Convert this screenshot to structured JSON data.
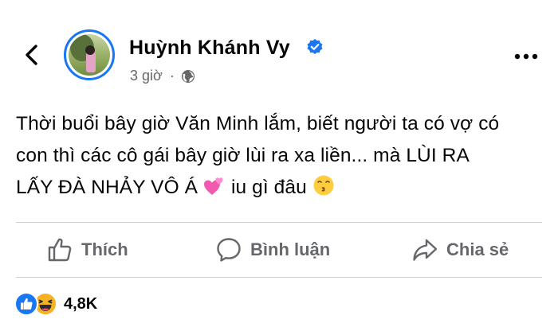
{
  "post": {
    "author_name": "Huỳnh Khánh Vy",
    "timestamp": "3 giờ",
    "separator": "·",
    "text_lines": [
      "Thời buổi bây giờ Văn Minh lắm, biết người ta có vợ có",
      "con thì các cô gái bây giờ lùi ra xa liền... mà LÙI RA",
      "LẤY ĐÀ NHẢY VÔ Á"
    ],
    "text_tail": "iu gì đâu"
  },
  "actions": {
    "like_label": "Thích",
    "comment_label": "Bình luận",
    "share_label": "Chia sẻ"
  },
  "reactions": {
    "count": "4,8K",
    "icons": [
      "like-reaction-icon",
      "haha-reaction-icon"
    ]
  },
  "icons": {
    "back": "chevron-left-icon",
    "verified": "verified-badge-icon",
    "privacy": "globe-icon",
    "more": "more-horizontal-icon",
    "inline_emoji_1": "two-hearts-emoji",
    "inline_emoji_2": "kissing-face-emoji"
  },
  "colors": {
    "accent": "#1877f2",
    "secondary_text": "#65676b",
    "divider": "#ced0d4",
    "haha_yellow": "#f7b125"
  }
}
